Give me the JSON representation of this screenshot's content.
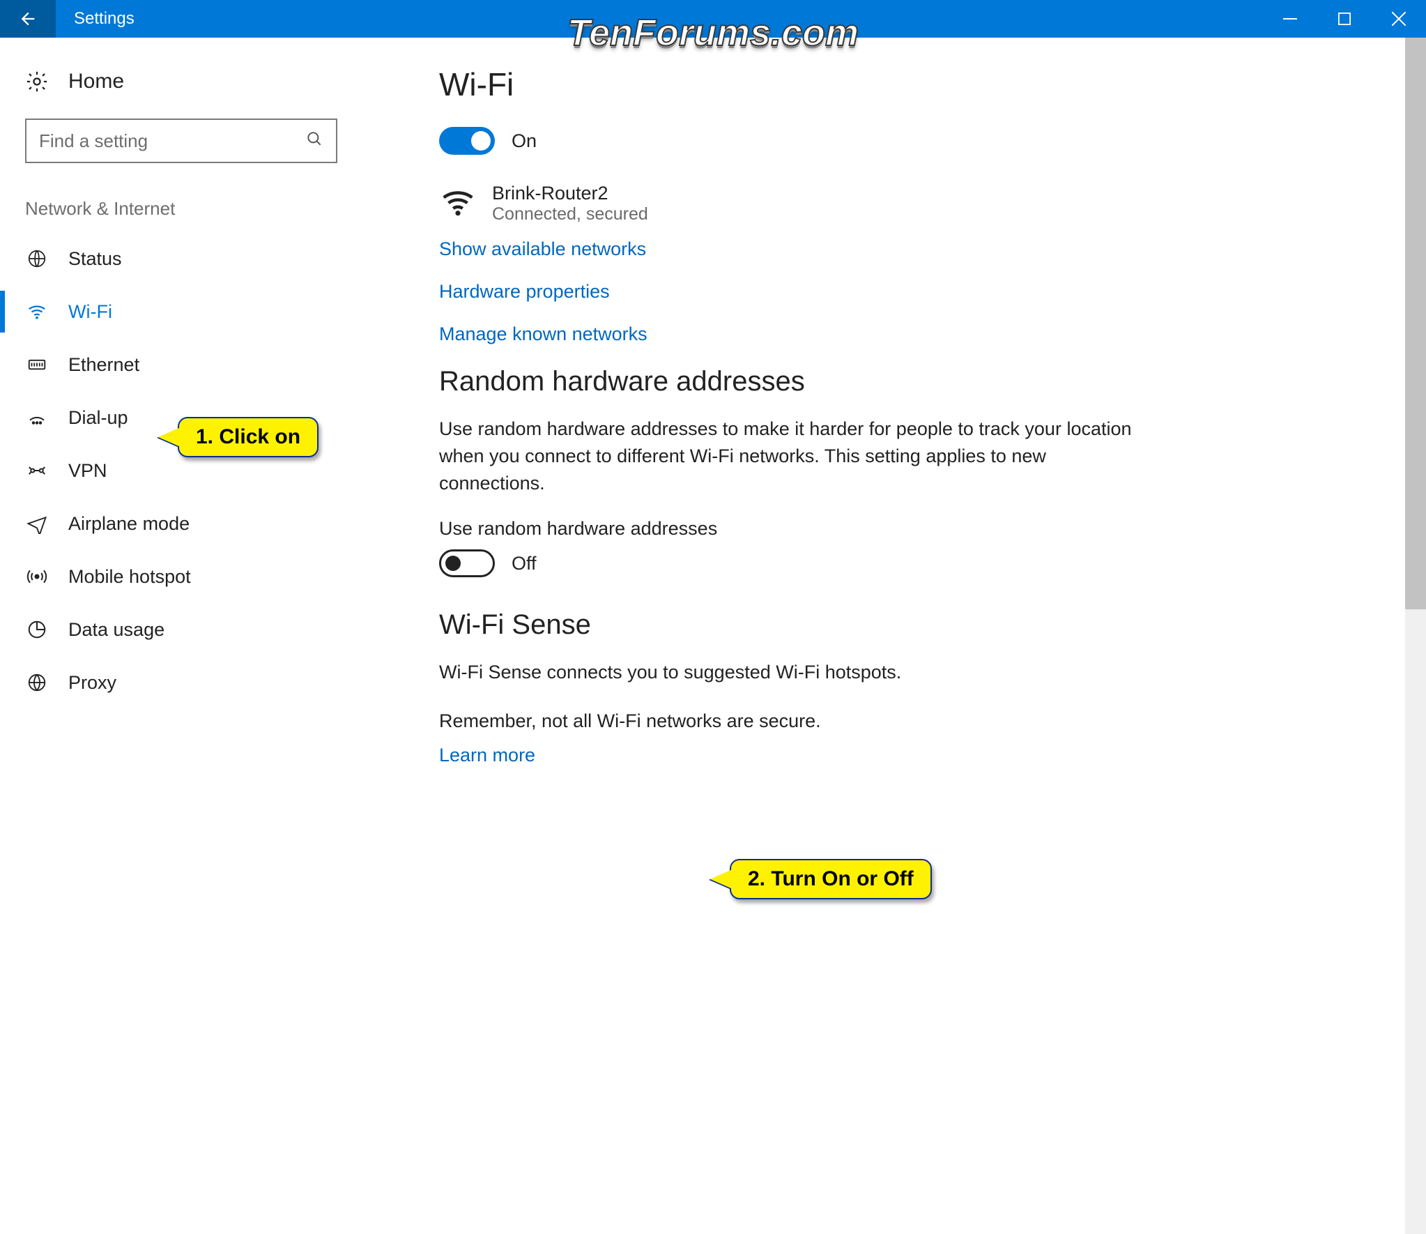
{
  "window": {
    "title": "Settings",
    "watermark": "TenForums.com"
  },
  "sidebar": {
    "home_label": "Home",
    "search_placeholder": "Find a setting",
    "section_label": "Network & Internet",
    "items": [
      {
        "label": "Status"
      },
      {
        "label": "Wi-Fi"
      },
      {
        "label": "Ethernet"
      },
      {
        "label": "Dial-up"
      },
      {
        "label": "VPN"
      },
      {
        "label": "Airplane mode"
      },
      {
        "label": "Mobile hotspot"
      },
      {
        "label": "Data usage"
      },
      {
        "label": "Proxy"
      }
    ]
  },
  "main": {
    "page_title": "Wi-Fi",
    "wifi_toggle": {
      "state_label": "On"
    },
    "network": {
      "name": "Brink-Router2",
      "status": "Connected, secured"
    },
    "links": {
      "show_networks": "Show available networks",
      "hardware_properties": "Hardware properties",
      "manage_known": "Manage known networks"
    },
    "random_hw": {
      "heading": "Random hardware addresses",
      "body": "Use random hardware addresses to make it harder for people to track your location when you connect to different Wi-Fi networks. This setting applies to new connections.",
      "toggle_label": "Use random hardware addresses",
      "toggle_state": "Off"
    },
    "wifi_sense": {
      "heading": "Wi-Fi Sense",
      "line1": "Wi-Fi Sense connects you to suggested Wi-Fi hotspots.",
      "line2": "Remember, not all Wi-Fi networks are secure.",
      "learn_more": "Learn more"
    }
  },
  "callouts": {
    "c1": "1. Click on",
    "c2": "2. Turn On or Off"
  }
}
